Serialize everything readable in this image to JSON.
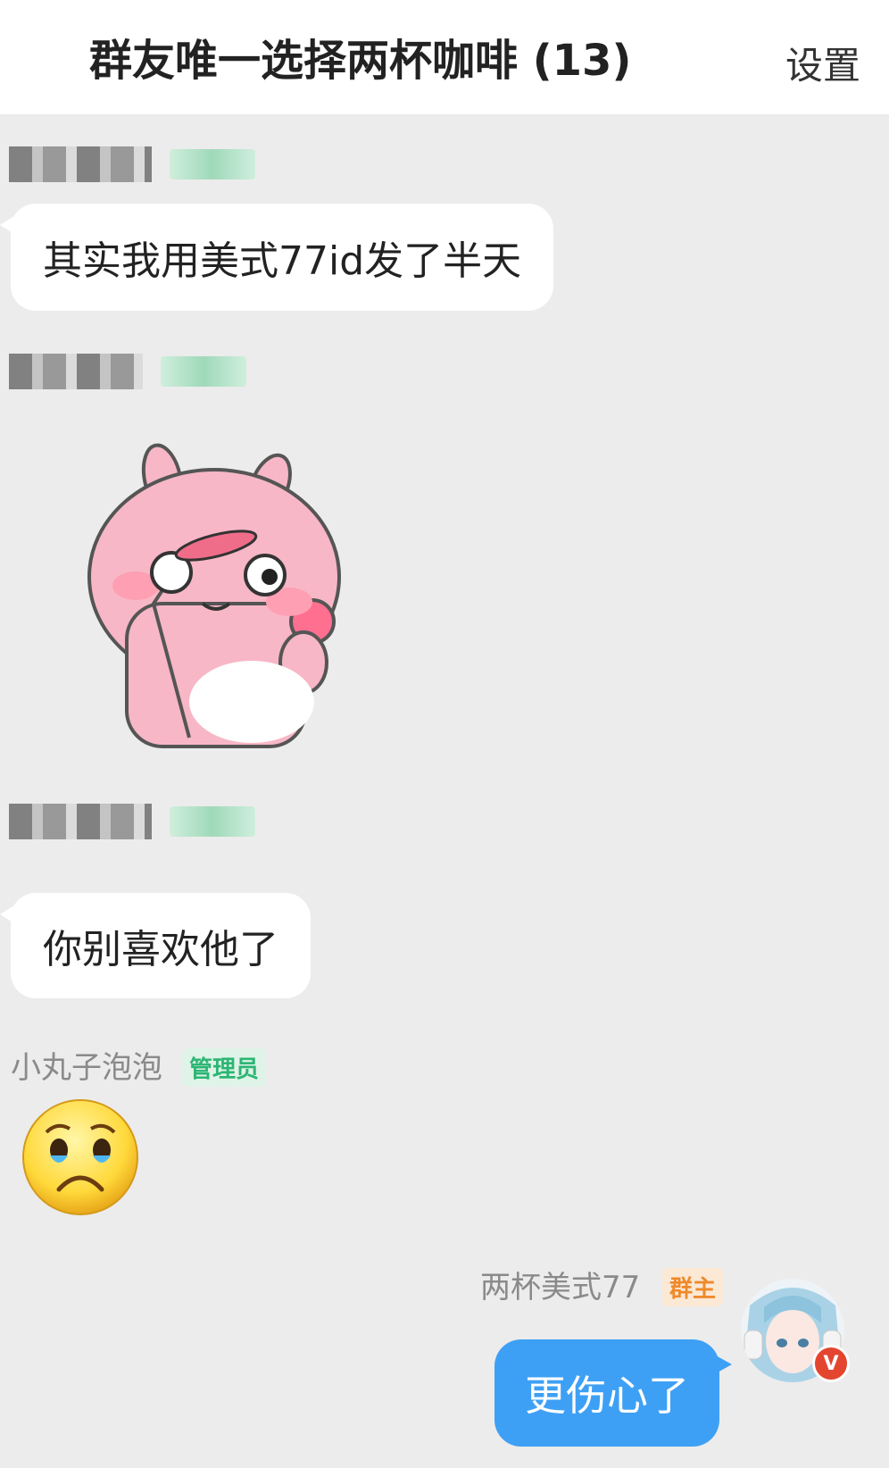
{
  "header": {
    "title": "群友唯一选择两杯咖啡 (13)",
    "settings_label": "设置"
  },
  "messages": [
    {
      "text": "其实我用美式77id发了半天"
    },
    {
      "sticker": "pink-bunny-sticker"
    },
    {
      "text": "你别喜欢他了"
    },
    {
      "sender": "小丸子泡泡",
      "badge": "管理员",
      "emoji": "crying-face-emoji"
    }
  ],
  "self": {
    "name": "两杯美式77",
    "badge": "群主",
    "text": "更伤心了",
    "avatar_badge": "V"
  },
  "colors": {
    "bubble_self": "#3ea0f5",
    "admin_badge": "#2bb673",
    "owner_badge": "#ee8a2c"
  }
}
